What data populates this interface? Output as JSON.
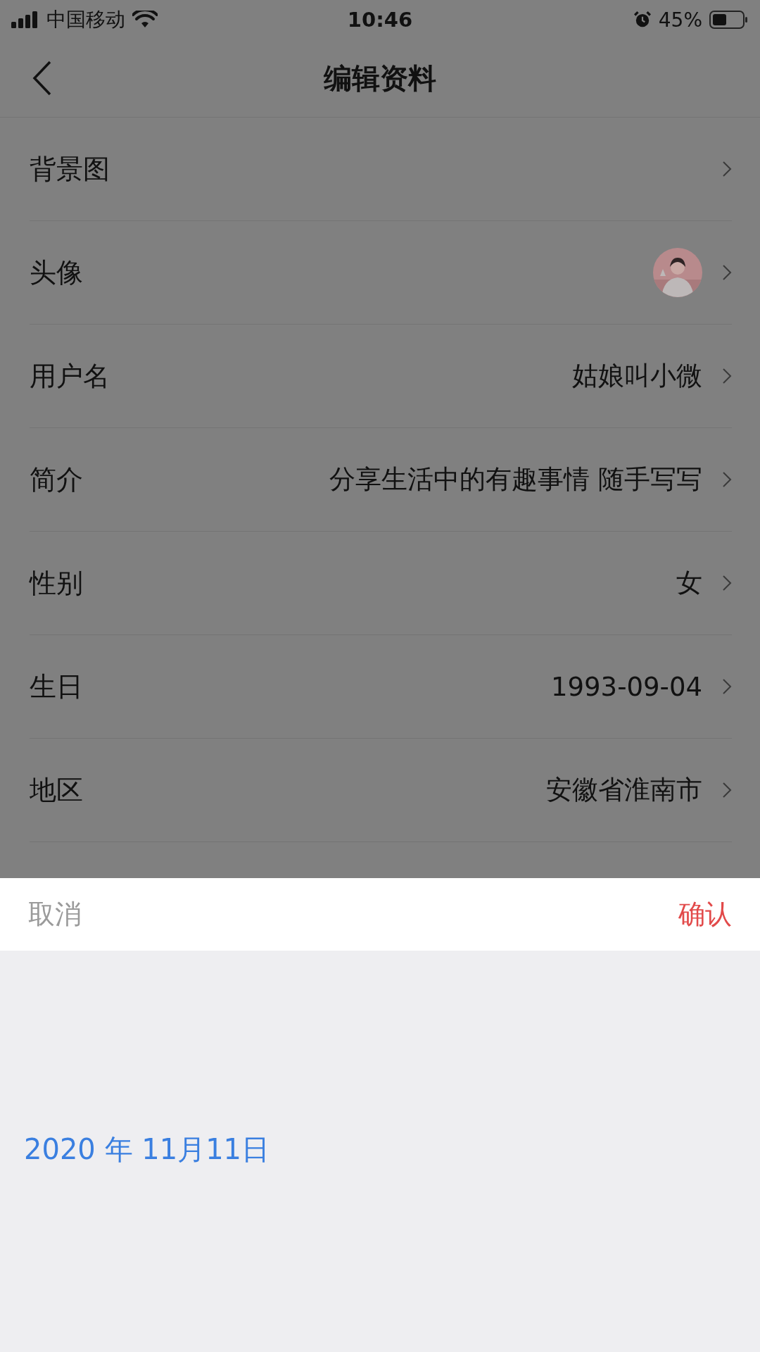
{
  "status_bar": {
    "carrier": "中国移动",
    "time": "10:46",
    "battery": "45%"
  },
  "nav": {
    "title": "编辑资料"
  },
  "rows": [
    {
      "label": "背景图",
      "kind": "link"
    },
    {
      "label": "头像",
      "kind": "avatar"
    },
    {
      "label": "用户名",
      "kind": "text",
      "value": "姑娘叫小微"
    },
    {
      "label": "简介",
      "kind": "text",
      "value": "分享生活中的有趣事情 随手写写"
    },
    {
      "label": "性别",
      "kind": "text",
      "value": "女"
    },
    {
      "label": "生日",
      "kind": "text",
      "value": "1993-09-04"
    },
    {
      "label": "地区",
      "kind": "text",
      "value": "安徽省淮南市"
    }
  ],
  "sheet": {
    "cancel": "取消",
    "confirm": "确认",
    "picker_value": "2020 年 11月11日"
  }
}
